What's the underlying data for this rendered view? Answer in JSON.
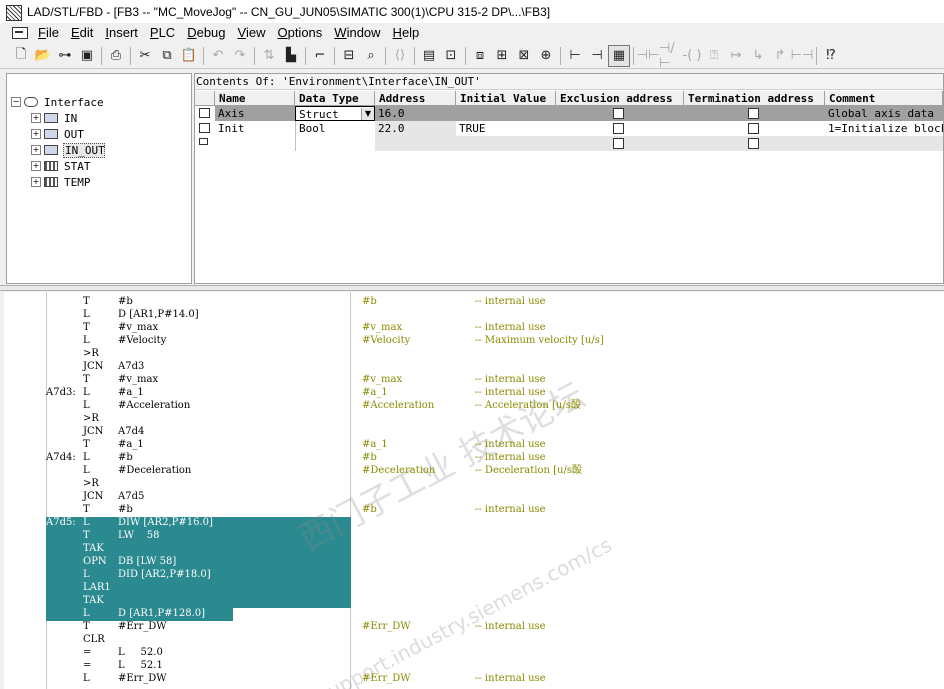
{
  "window": {
    "title": "LAD/STL/FBD  - [FB3 -- \"MC_MoveJog\" -- CN_GU_JUN05\\SIMATIC 300(1)\\CPU 315-2 DP\\...\\FB3]"
  },
  "menu": [
    "File",
    "Edit",
    "Insert",
    "PLC",
    "Debug",
    "View",
    "Options",
    "Window",
    "Help"
  ],
  "toolbar": {
    "icons": [
      "new-icon",
      "open-icon",
      "access-icon",
      "save-icon",
      "print-icon",
      "cut-icon",
      "copy-icon",
      "paste-icon",
      "undo-icon",
      "redo-icon",
      "load-icon",
      "monitor-icon",
      "comment-icon",
      "network-icon",
      "overview-icon",
      "compare-icon",
      "window-icon",
      "split-icon",
      "details-icon",
      "network-insert-icon",
      "contact-icon",
      "coil-icon",
      "contact-no-icon",
      "contact-nc-icon",
      "coil-out-icon",
      "box-icon",
      "branch-open-icon",
      "branch-close-icon",
      "arrow-icon",
      "jump-icon",
      "help-icon"
    ]
  },
  "tree": {
    "root": "Interface",
    "items": [
      {
        "label": "IN",
        "selected": false
      },
      {
        "label": "OUT",
        "selected": false
      },
      {
        "label": "IN_OUT",
        "selected": true
      },
      {
        "label": "STAT",
        "selected": false
      },
      {
        "label": "TEMP",
        "selected": false
      }
    ]
  },
  "declaration": {
    "path": "Contents Of: 'Environment\\Interface\\IN_OUT'",
    "columns": [
      "Name",
      "Data Type",
      "Address",
      "Initial Value",
      "Exclusion address",
      "Termination address",
      "Comment"
    ],
    "rows": [
      {
        "name": "Axis",
        "type": "Struct",
        "address": "16.0",
        "initial": "",
        "comment": "Global axis data",
        "exclusion": false,
        "termination": false
      },
      {
        "name": "Init",
        "type": "Bool",
        "address": "22.0",
        "initial": "TRUE",
        "comment": "1=Initialize block",
        "exclusion": false,
        "termination": false
      },
      {
        "name": "",
        "type": "",
        "address": "",
        "initial": "",
        "comment": "",
        "exclusion": false,
        "termination": false
      }
    ]
  },
  "code": {
    "lines": [
      {
        "label": "",
        "op": "T",
        "arg": "#b",
        "sym": "#b",
        "cmt": "-- internal use"
      },
      {
        "label": "",
        "op": "L",
        "arg": "D [AR1,P#14.0]",
        "sym": "",
        "cmt": ""
      },
      {
        "label": "",
        "op": "T",
        "arg": "#v_max",
        "sym": "#v_max",
        "cmt": "-- internal use"
      },
      {
        "label": "",
        "op": "L",
        "arg": "#Velocity",
        "sym": "#Velocity",
        "cmt": "-- Maximum velocity [u/s]"
      },
      {
        "label": "",
        "op": ">R",
        "arg": "",
        "sym": "",
        "cmt": ""
      },
      {
        "label": "",
        "op": "JCN",
        "arg": "A7d3",
        "sym": "",
        "cmt": ""
      },
      {
        "label": "",
        "op": "T",
        "arg": "#v_max",
        "sym": "#v_max",
        "cmt": "-- internal use"
      },
      {
        "label": "A7d3:",
        "op": "L",
        "arg": "#a_1",
        "sym": "#a_1",
        "cmt": "-- internal use"
      },
      {
        "label": "",
        "op": "L",
        "arg": "#Acceleration",
        "sym": "#Acceleration",
        "cmt": "-- Acceleration [u/s酘"
      },
      {
        "label": "",
        "op": ">R",
        "arg": "",
        "sym": "",
        "cmt": ""
      },
      {
        "label": "",
        "op": "JCN",
        "arg": "A7d4",
        "sym": "",
        "cmt": ""
      },
      {
        "label": "",
        "op": "T",
        "arg": "#a_1",
        "sym": "#a_1",
        "cmt": "-- internal use"
      },
      {
        "label": "A7d4:",
        "op": "L",
        "arg": "#b",
        "sym": "#b",
        "cmt": "-- internal use"
      },
      {
        "label": "",
        "op": "L",
        "arg": "#Deceleration",
        "sym": "#Deceleration",
        "cmt": "-- Deceleration [u/s酘"
      },
      {
        "label": "",
        "op": ">R",
        "arg": "",
        "sym": "",
        "cmt": ""
      },
      {
        "label": "",
        "op": "JCN",
        "arg": "A7d5",
        "sym": "",
        "cmt": ""
      },
      {
        "label": "",
        "op": "T",
        "arg": "#b",
        "sym": "#b",
        "cmt": "-- internal use"
      },
      {
        "label": "A7d5:",
        "op": "L",
        "arg": "DIW [AR2,P#16.0]",
        "sym": "",
        "cmt": "",
        "hl": true
      },
      {
        "label": "",
        "op": "T",
        "arg": "LW    58",
        "sym": "",
        "cmt": "",
        "hl": true
      },
      {
        "label": "",
        "op": "TAK",
        "arg": "",
        "sym": "",
        "cmt": "",
        "hl": true
      },
      {
        "label": "",
        "op": "OPN",
        "arg": "DB [LW 58]",
        "sym": "",
        "cmt": "",
        "hl": true
      },
      {
        "label": "",
        "op": "L",
        "arg": "DID [AR2,P#18.0]",
        "sym": "",
        "cmt": "",
        "hl": true
      },
      {
        "label": "",
        "op": "LAR1",
        "arg": "",
        "sym": "",
        "cmt": "",
        "hl": true
      },
      {
        "label": "",
        "op": "TAK",
        "arg": "",
        "sym": "",
        "cmt": "",
        "hl": true
      },
      {
        "label": "",
        "op": "L",
        "arg": "D [AR1,P#128.0]",
        "sym": "",
        "cmt": "",
        "hl": true
      },
      {
        "label": "",
        "op": "T",
        "arg": "#Err_DW",
        "sym": "#Err_DW",
        "cmt": "-- internal use"
      },
      {
        "label": "",
        "op": "CLR",
        "arg": "",
        "sym": "",
        "cmt": ""
      },
      {
        "label": "",
        "op": "=",
        "arg": "L     52.0",
        "sym": "",
        "cmt": ""
      },
      {
        "label": "",
        "op": "=",
        "arg": "L     52.1",
        "sym": "",
        "cmt": ""
      },
      {
        "label": "",
        "op": "L",
        "arg": "#Err_DW",
        "sym": "#Err_DW",
        "cmt": "-- internal use"
      }
    ]
  },
  "watermark": {
    "text": "西门子工业 技术论坛",
    "url": "support.industry.siemens.com/cs"
  }
}
